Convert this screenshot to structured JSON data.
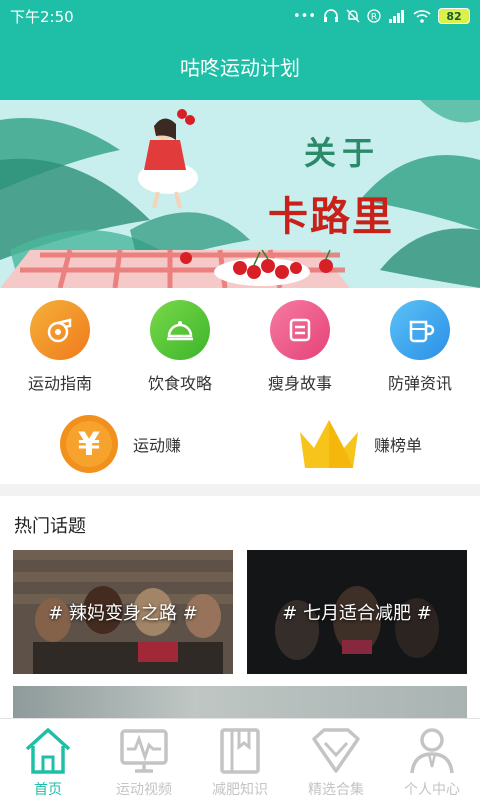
{
  "status_bar": {
    "time": "下午2:50",
    "signal_text": "•••",
    "battery": "82"
  },
  "header": {
    "title": "咕咚运动计划"
  },
  "banner": {
    "line1": "关于",
    "line2": "卡路里"
  },
  "categories": [
    {
      "label": "运动指南",
      "icon": "whistle-icon",
      "color": "#f59a23"
    },
    {
      "label": "饮食攻略",
      "icon": "food-cover-icon",
      "color": "#55c93a"
    },
    {
      "label": "瘦身故事",
      "icon": "notebook-icon",
      "color": "#ef5f8c"
    },
    {
      "label": "防弹资讯",
      "icon": "cup-icon",
      "color": "#3aa6ee"
    }
  ],
  "earn": [
    {
      "label": "运动赚",
      "icon": "yuan-coin-icon",
      "symbol": "¥"
    },
    {
      "label": "赚榜单",
      "icon": "crown-icon"
    }
  ],
  "topics": {
    "title": "热门话题",
    "items": [
      {
        "label": "# 辣妈变身之路 #"
      },
      {
        "label": "# 七月适合减肥 #"
      }
    ]
  },
  "bottom_nav": [
    {
      "label": "首页",
      "icon": "home-icon",
      "active": true
    },
    {
      "label": "运动视频",
      "icon": "monitor-pulse-icon",
      "active": false
    },
    {
      "label": "减肥知识",
      "icon": "book-icon",
      "active": false
    },
    {
      "label": "精选合集",
      "icon": "diamond-icon",
      "active": false
    },
    {
      "label": "个人中心",
      "icon": "person-icon",
      "active": false
    }
  ]
}
